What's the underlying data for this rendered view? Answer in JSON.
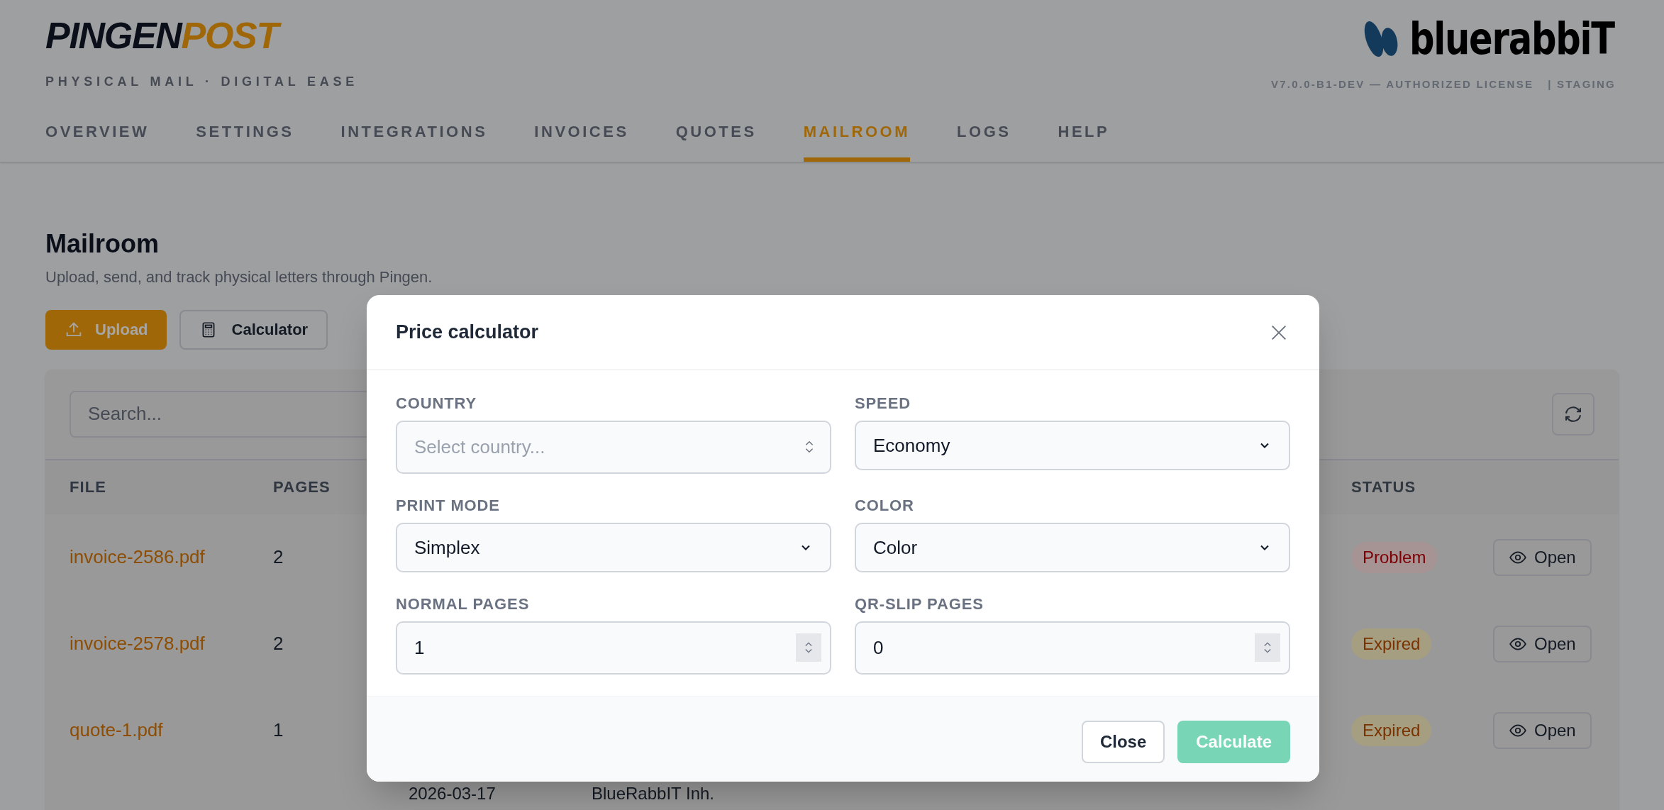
{
  "brand": {
    "name_dark": "PINGEN",
    "name_accent": "POST",
    "tagline": "PHYSICAL MAIL · DIGITAL EASE"
  },
  "partner_logo": {
    "text": "bluerabbiT"
  },
  "build": {
    "version": "V7.0.0-B1-DEV — AUTHORIZED LICENSE",
    "environment": "| STAGING"
  },
  "nav": [
    {
      "label": "OVERVIEW",
      "selected": false
    },
    {
      "label": "SETTINGS",
      "selected": false
    },
    {
      "label": "INTEGRATIONS",
      "selected": false
    },
    {
      "label": "INVOICES",
      "selected": false
    },
    {
      "label": "QUOTES",
      "selected": false
    },
    {
      "label": "MAILROOM",
      "selected": true
    },
    {
      "label": "LOGS",
      "selected": false
    },
    {
      "label": "HELP",
      "selected": false
    }
  ],
  "page": {
    "title": "Mailroom",
    "subtitle": "Upload, send, and track physical letters through Pingen."
  },
  "actions": [
    {
      "label": "Upload",
      "kind": "primary"
    },
    {
      "label": "Calculator",
      "kind": "secondary"
    }
  ],
  "table": {
    "search": {
      "placeholder": "Search..."
    },
    "columns": [
      "FILE",
      "PAGES",
      "STATUS"
    ],
    "rows": [
      {
        "file": "invoice-2586.pdf",
        "pages": "2",
        "status": {
          "label": "Problem",
          "kind": "danger"
        },
        "action": "Open"
      },
      {
        "file": "invoice-2578.pdf",
        "pages": "2",
        "status": {
          "label": "Expired",
          "kind": "warning"
        },
        "action": "Open"
      },
      {
        "file": "quote-1.pdf",
        "pages": "1",
        "status": {
          "label": "Expired",
          "kind": "warning"
        },
        "action": "Open"
      },
      {
        "column_3": "2026-03-17",
        "column_4": "BlueRabbIT Inh."
      }
    ]
  },
  "dialog": {
    "title": "Price calculator",
    "fields": [
      {
        "label": "COUNTRY",
        "kind": "combobox",
        "placeholder": "Select country..."
      },
      {
        "label": "SPEED",
        "kind": "select",
        "value": "Economy"
      },
      {
        "label": "PRINT MODE",
        "kind": "select",
        "value": "Simplex"
      },
      {
        "label": "COLOR",
        "kind": "select",
        "value": "Color"
      },
      {
        "label": "NORMAL PAGES",
        "kind": "number",
        "value": "1"
      },
      {
        "label": "QR-SLIP PAGES",
        "kind": "number",
        "value": "0"
      }
    ],
    "buttons": [
      {
        "label": "Close",
        "kind": "secondary",
        "disabled": false
      },
      {
        "label": "Calculate",
        "kind": "primary",
        "disabled": true
      }
    ]
  }
}
